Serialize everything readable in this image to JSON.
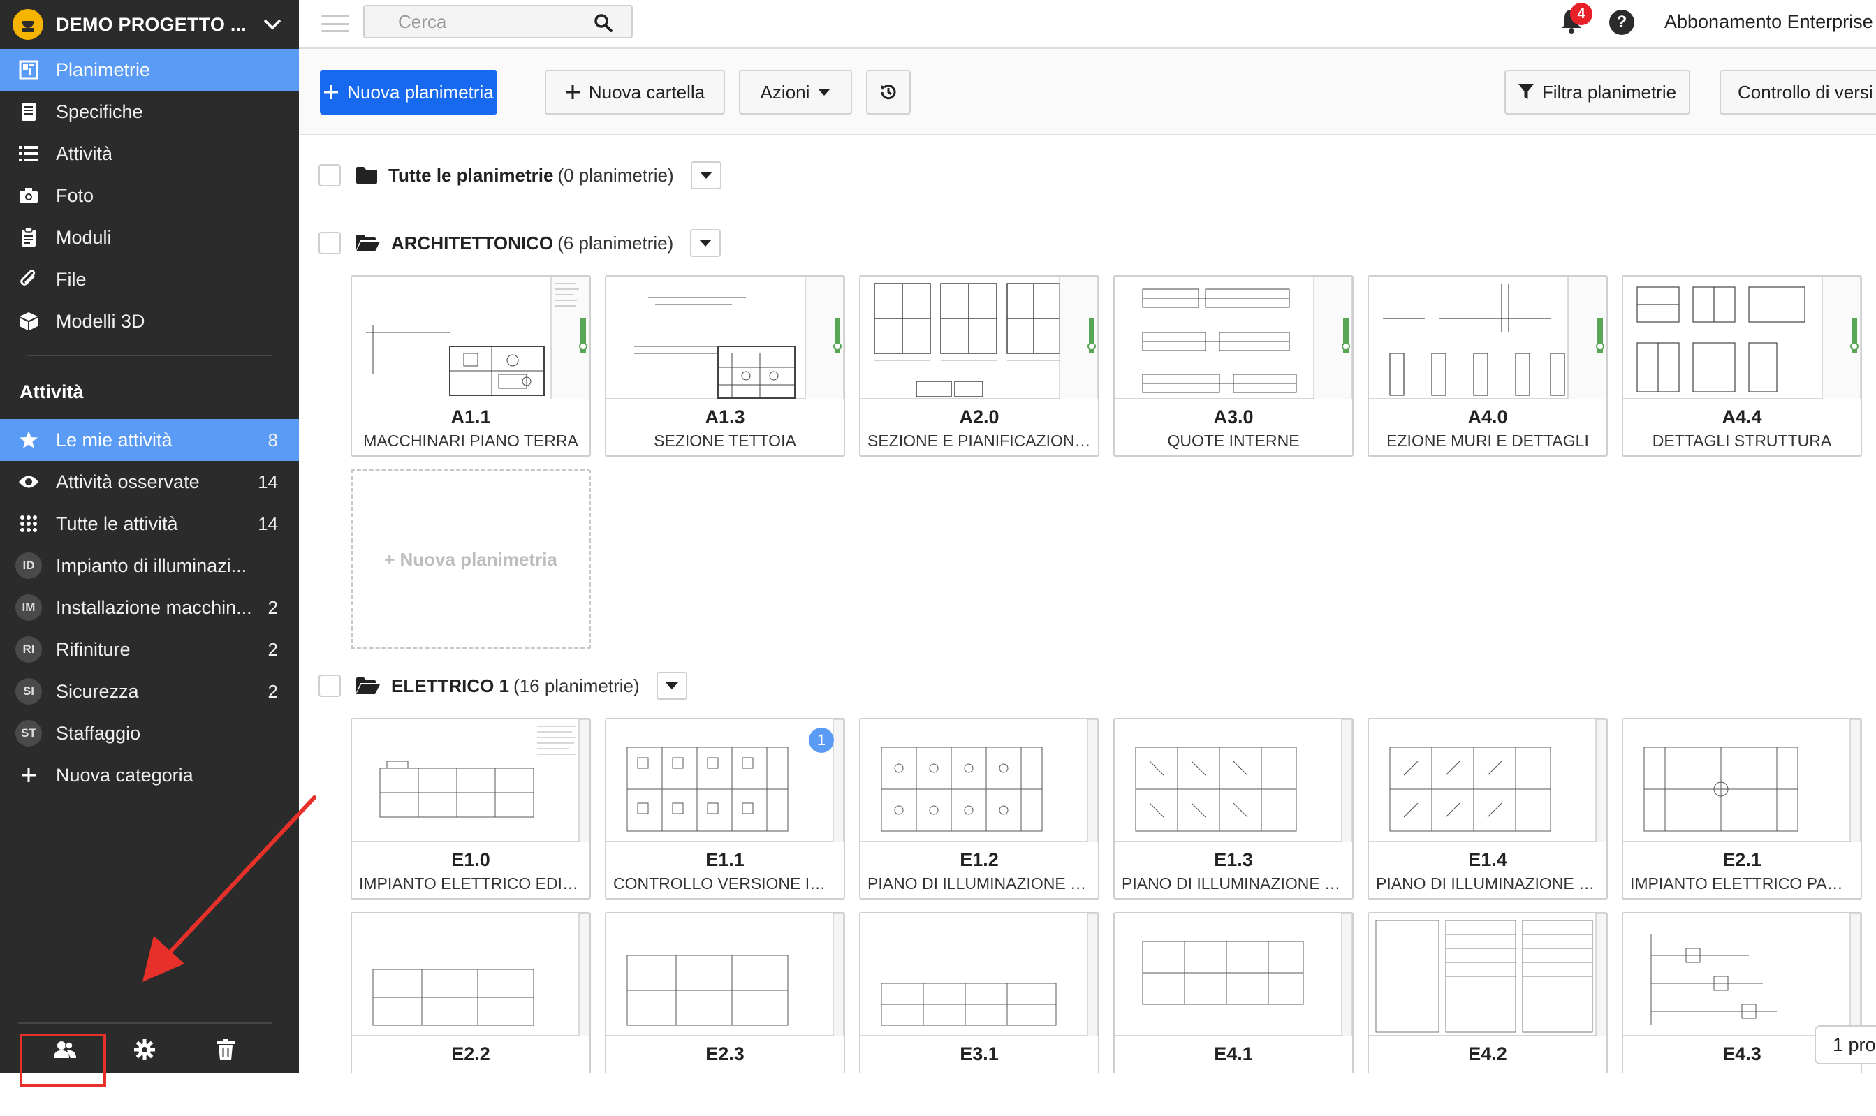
{
  "project": {
    "title": "DEMO PROGETTO ..."
  },
  "nav": [
    {
      "label": "Planimetrie",
      "icon": "blueprint-icon",
      "active": true
    },
    {
      "label": "Specifiche",
      "icon": "book-icon"
    },
    {
      "label": "Attività",
      "icon": "list-icon"
    },
    {
      "label": "Foto",
      "icon": "camera-icon"
    },
    {
      "label": "Moduli",
      "icon": "clipboard-icon"
    },
    {
      "label": "File",
      "icon": "paperclip-icon"
    },
    {
      "label": "Modelli 3D",
      "icon": "cube-icon"
    }
  ],
  "tasks_section": {
    "title": "Attività",
    "items": [
      {
        "label": "Le mie attività",
        "count": "8",
        "icon": "star-icon",
        "active": true
      },
      {
        "label": "Attività osservate",
        "count": "14",
        "icon": "eye-icon"
      },
      {
        "label": "Tutte le attività",
        "count": "14",
        "icon": "grid-icon"
      },
      {
        "label": "Impianto di illuminazi...",
        "count": "",
        "abbr": "ID"
      },
      {
        "label": "Installazione macchin...",
        "count": "2",
        "abbr": "IM"
      },
      {
        "label": "Rifiniture",
        "count": "2",
        "abbr": "RI"
      },
      {
        "label": "Sicurezza",
        "count": "2",
        "abbr": "SI"
      },
      {
        "label": "Staffaggio",
        "count": "",
        "abbr": "ST"
      },
      {
        "label": "Nuova categoria",
        "count": "",
        "icon": "plus-icon"
      }
    ]
  },
  "topbar": {
    "search_placeholder": "Cerca",
    "notifications": "4",
    "help": "?",
    "plan": "Abbonamento Enterprise"
  },
  "toolbar": {
    "new_plan": "Nuova planimetria",
    "new_folder": "Nuova cartella",
    "actions": "Azioni",
    "filter": "Filtra planimetrie",
    "version": "Controllo di versi"
  },
  "folders": [
    {
      "name": "Tutte le planimetrie",
      "count": "(0 planimetrie)"
    },
    {
      "name": "ARCHITETTONICO",
      "count": "(6 planimetrie)"
    },
    {
      "name": "ELETTRICO 1",
      "count": "(16 planimetrie)"
    }
  ],
  "arch_sheets": [
    {
      "code": "A1.1",
      "title": "MACCHINARI PIANO TERRA"
    },
    {
      "code": "A1.3",
      "title": "SEZIONE TETTOIA"
    },
    {
      "code": "A2.0",
      "title": "SEZIONE E PIANIFICAZIONE..."
    },
    {
      "code": "A3.0",
      "title": "QUOTE INTERNE"
    },
    {
      "code": "A4.0",
      "title": "EZIONE MURI E DETTAGLI"
    },
    {
      "code": "A4.4",
      "title": "DETTAGLI STRUTTURA"
    }
  ],
  "new_sheet_label": "+ Nuova planimetria",
  "elec_sheets": [
    {
      "code": "E1.0",
      "title": "IMPIANTO ELETTRICO EDIFI..."
    },
    {
      "code": "E1.1",
      "title": "CONTROLLO VERSIONE IMP...",
      "version": "1"
    },
    {
      "code": "E1.2",
      "title": "PIANO DI ILLUMINAZIONE P..."
    },
    {
      "code": "E1.3",
      "title": "PIANO DI ILLUMINAZIONE P..."
    },
    {
      "code": "E1.4",
      "title": "PIANO DI ILLUMINAZIONE P..."
    },
    {
      "code": "E2.1",
      "title": "IMPIANTO ELETTRICO PARZ..."
    }
  ],
  "elec_sheets_row2": [
    {
      "code": "E2.2"
    },
    {
      "code": "E2.3"
    },
    {
      "code": "E3.1"
    },
    {
      "code": "E4.1"
    },
    {
      "code": "E4.2"
    },
    {
      "code": "E4.3"
    }
  ],
  "pager": "1 pro",
  "colors": {
    "sidebar": "#2b2b2b",
    "active": "#5a9bf6",
    "primary": "#1769f0",
    "annotation": "#e8302a"
  }
}
